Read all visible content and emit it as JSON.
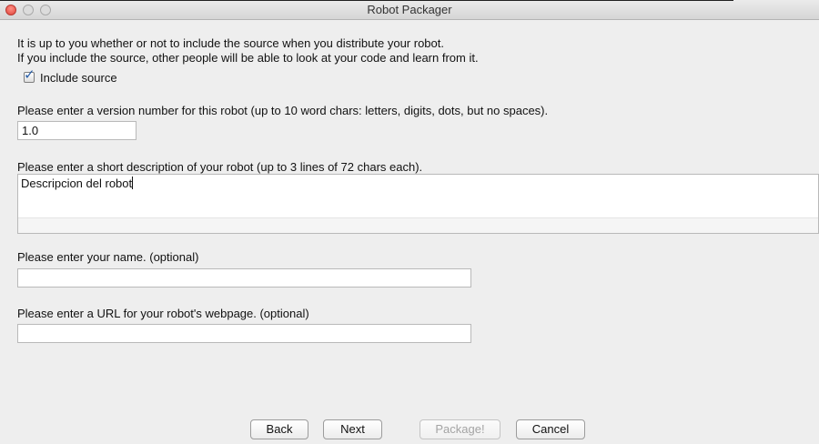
{
  "window": {
    "title": "Robot Packager"
  },
  "source_section": {
    "line1": "It is up to you whether or not to include the source when you distribute your robot.",
    "line2": "If you include the source, other people will be able to look at your code and learn from it.",
    "include_source_label": "Include source",
    "include_source_checked": true
  },
  "version_section": {
    "label": "Please enter a version number for this robot (up to 10 word chars: letters, digits, dots, but no spaces).",
    "value": "1.0"
  },
  "description_section": {
    "label": "Please enter a short description of your robot (up to 3 lines of 72 chars each).",
    "value": "Descripcion del robot"
  },
  "name_section": {
    "label": "Please enter your name. (optional)",
    "value": ""
  },
  "url_section": {
    "label": "Please enter a URL for your robot's webpage. (optional)",
    "value": ""
  },
  "buttons": {
    "back": "Back",
    "next": "Next",
    "package": "Package!",
    "cancel": "Cancel"
  },
  "icons": {
    "close": "close-icon",
    "minimize": "minimize-icon",
    "zoom": "zoom-icon",
    "checkmark": "checkmark-icon"
  },
  "colors": {
    "close_button": "#e0443b",
    "checkmark": "#2a5fa8",
    "window_background": "#eeeeee"
  }
}
